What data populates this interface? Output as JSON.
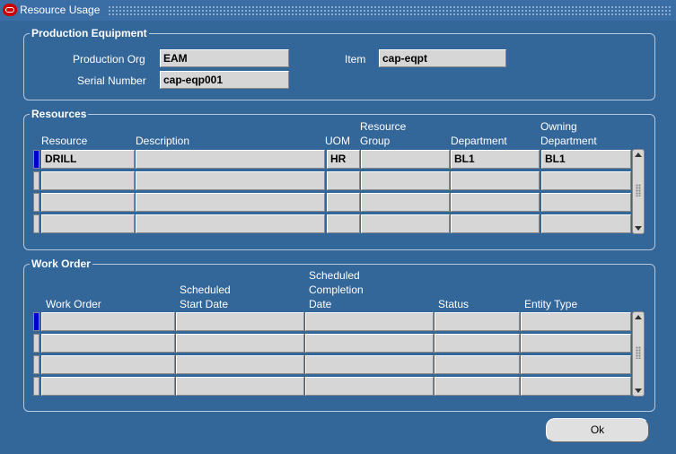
{
  "window": {
    "title": "Resource Usage"
  },
  "production": {
    "group_title": "Production Equipment",
    "org_label": "Production Org",
    "org_value": "EAM",
    "item_label": "Item",
    "item_value": "cap-eqpt",
    "serial_label": "Serial Number",
    "serial_value": "cap-eqp001"
  },
  "resources": {
    "group_title": "Resources",
    "headers": {
      "resource": "Resource",
      "description": "Description",
      "uom": "UOM",
      "group1": "Resource",
      "group2": "Group",
      "department": "Department",
      "owning1": "Owning",
      "owning2": "Department"
    },
    "rows": [
      {
        "resource": "DRILL",
        "description": "",
        "uom": "HR",
        "group": "",
        "department": "BL1",
        "owning": "BL1"
      },
      {
        "resource": "",
        "description": "",
        "uom": "",
        "group": "",
        "department": "",
        "owning": ""
      },
      {
        "resource": "",
        "description": "",
        "uom": "",
        "group": "",
        "department": "",
        "owning": ""
      },
      {
        "resource": "",
        "description": "",
        "uom": "",
        "group": "",
        "department": "",
        "owning": ""
      }
    ]
  },
  "work_order": {
    "group_title": "Work Order",
    "headers": {
      "work_order": "Work Order",
      "start1": "Scheduled",
      "start2": "Start Date",
      "comp1": "Scheduled",
      "comp2": "Completion",
      "comp3": "Date",
      "status": "Status",
      "entity": "Entity Type"
    }
  },
  "ok_label": "Ok"
}
